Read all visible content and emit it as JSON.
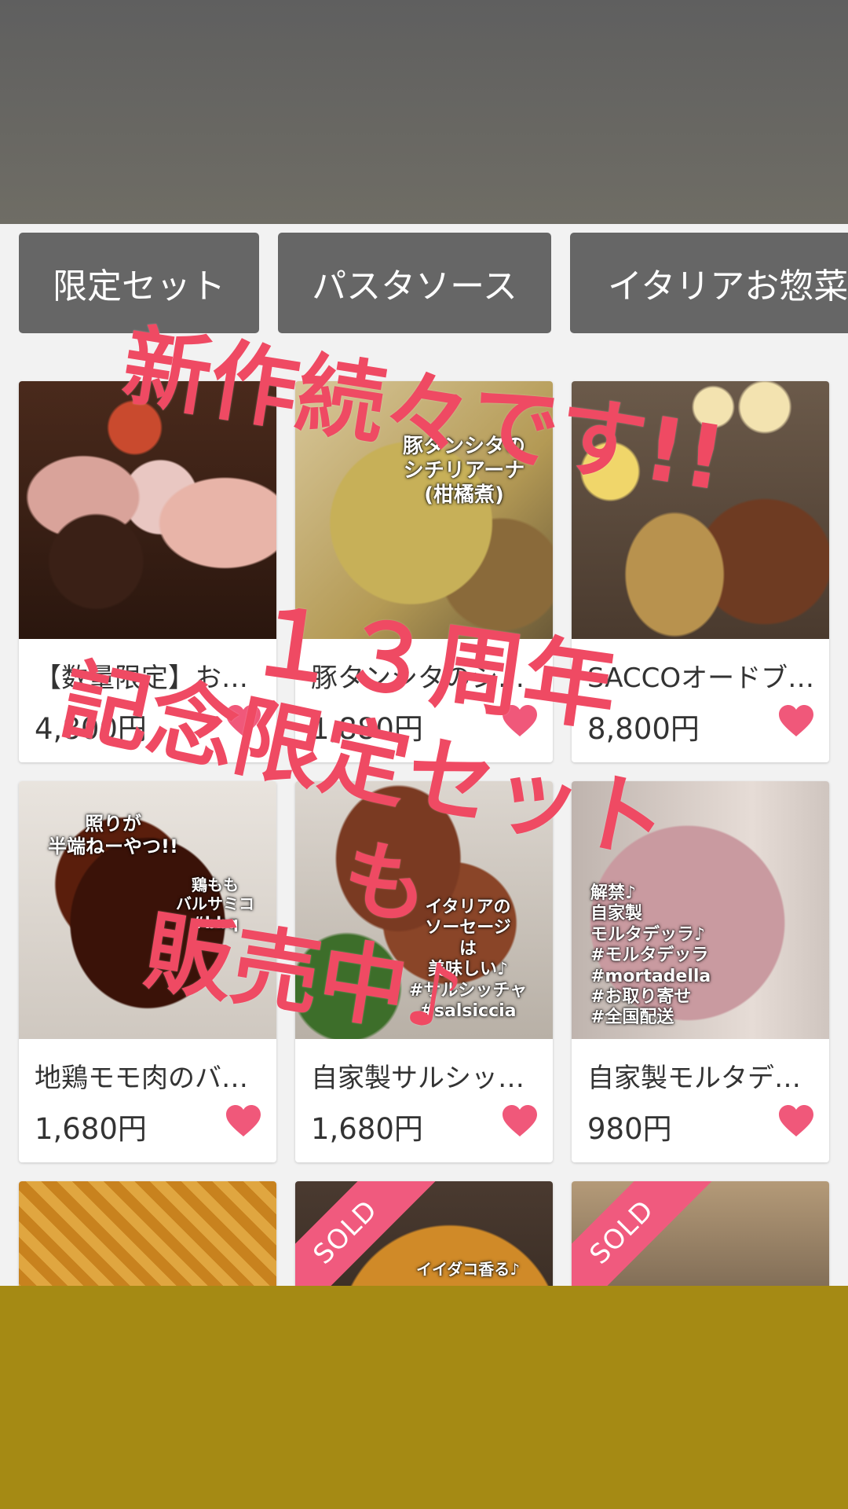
{
  "tabs": [
    "限定セット",
    "パスタソース",
    "イタリアお惣菜"
  ],
  "products": [
    {
      "title": "【数量限定】お…",
      "price": "4,800円",
      "caption": ""
    },
    {
      "title": "豚タンシタのシ…",
      "price": "1,880円",
      "caption": "豚タンシタの\nシチリアーナ\n(柑橘煮)"
    },
    {
      "title": "SACCOオードブ…",
      "price": "8,800円",
      "caption": ""
    },
    {
      "title": "地鶏モモ肉のバ…",
      "price": "1,680円",
      "caption": "照りが\n半端ねーやつ!!"
    },
    {
      "title": "自家製サルシッ…",
      "price": "1,680円",
      "caption": "イタリアの\nソーセージ\nは\n美味しい♪\n#サルシッチャ\n#salsiccia"
    },
    {
      "title": "自家製モルタデ…",
      "price": "980円",
      "caption": "解禁♪\n自家製\nモルタデッラ♪\n#モルタデッラ\n#mortadella\n#お取り寄せ\n#全国配送"
    }
  ],
  "sub_captions": {
    "chicken": "鶏もも\nバルサミコ\n#bbq"
  },
  "bottom_cards": [
    {
      "sold": false,
      "caption": ""
    },
    {
      "sold": true,
      "caption": "イイダコ香る♪"
    },
    {
      "sold": true,
      "caption": ""
    }
  ],
  "sold_label": "SOLD",
  "overlay": {
    "line1": "新作続々です!!",
    "line2": "１３周年",
    "line3": "記念限定セット",
    "line4": "も",
    "line5": "販売中♪"
  },
  "colors": {
    "heart": "#f0587a",
    "overlay_text": "#ef4a63",
    "tab_bg": "#666666",
    "sold_ribbon": "#f05a7e",
    "bottom_band": "#a58a14"
  }
}
